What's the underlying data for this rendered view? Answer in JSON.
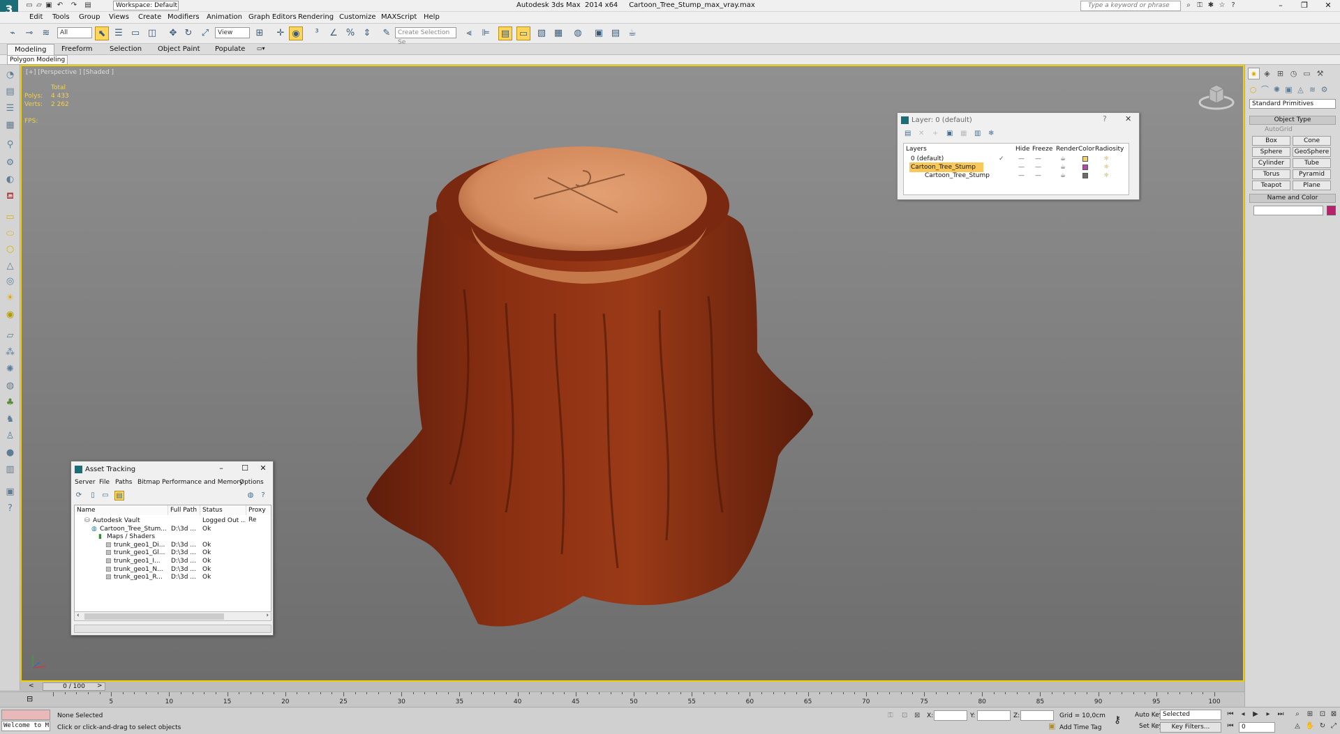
{
  "app": {
    "window_title": "Autodesk 3ds Max  2014 x64     Cartoon_Tree_Stump_max_vray.max",
    "workspace": "Workspace: Default",
    "search_placeholder": "Type a keyword or phrase"
  },
  "menu": [
    "Edit",
    "Tools",
    "Group",
    "Views",
    "Create",
    "Modifiers",
    "Animation",
    "Graph Editors",
    "Rendering",
    "Customize",
    "MAXScript",
    "Help"
  ],
  "toolbar": {
    "selection_filter": "All",
    "ref_coord": "View",
    "named_selection_placeholder": "Create Selection Se"
  },
  "ribbon": {
    "tabs": [
      "Modeling",
      "Freeform",
      "Selection",
      "Object Paint",
      "Populate"
    ],
    "panel_label": "Polygon Modeling"
  },
  "viewport": {
    "label": "[+] [Perspective ] [Shaded ]",
    "stats_header": "Total",
    "polys_label": "Polys:",
    "polys_value": "4 433",
    "verts_label": "Verts:",
    "verts_value": "2 262",
    "fps_label": "FPS:"
  },
  "timeline": {
    "frame_display": "0 / 100",
    "ticks": [
      "5",
      "10",
      "15",
      "20",
      "25",
      "30",
      "35",
      "40",
      "45",
      "50",
      "55",
      "60",
      "65",
      "70",
      "75",
      "80",
      "85",
      "90",
      "95",
      "100"
    ]
  },
  "status": {
    "maxscript_text": "Welcome to M",
    "selection_text": "None Selected",
    "prompt_text": "Click or click-and-drag to select objects",
    "x_label": "X:",
    "y_label": "Y:",
    "z_label": "Z:",
    "grid_text": "Grid = 10,0cm",
    "add_time_tag": "Add Time Tag",
    "auto_key": "Auto Key",
    "set_key": "Set Key",
    "selected_dd": "Selected",
    "key_filters": "Key Filters...",
    "current_frame": "0"
  },
  "command_panel": {
    "category": "Standard Primitives",
    "object_type_title": "Object Type",
    "autogrid_label": "AutoGrid",
    "buttons": [
      "Box",
      "Cone",
      "Sphere",
      "GeoSphere",
      "Cylinder",
      "Tube",
      "Torus",
      "Pyramid",
      "Teapot",
      "Plane"
    ],
    "name_color_title": "Name and Color",
    "object_color": "#b8216c"
  },
  "layer_dialog": {
    "title": "Layer: 0 (default)",
    "columns": [
      "Layers",
      "Hide",
      "Freeze",
      "Render",
      "Color",
      "Radiosity"
    ],
    "rows": [
      {
        "name": "0 (default)",
        "color": "#f2d36b",
        "current": "✓",
        "selected": false,
        "indent": 0
      },
      {
        "name": "Cartoon_Tree_Stump",
        "color": "#b24aa8",
        "current": "",
        "selected": true,
        "indent": 0
      },
      {
        "name": "Cartoon_Tree_Stump",
        "color": "#6c6c6c",
        "current": "",
        "selected": false,
        "indent": 1
      }
    ]
  },
  "asset_dialog": {
    "title": "Asset Tracking",
    "menus": [
      "Server",
      "File",
      "Paths",
      "Bitmap Performance and Memory",
      "Options"
    ],
    "columns": [
      "Name",
      "Full Path",
      "Status",
      "Proxy Re"
    ],
    "rows": [
      {
        "name": "Autodesk Vault",
        "path": "",
        "status": "Logged Out ...",
        "indent": 0
      },
      {
        "name": "Cartoon_Tree_Stum...",
        "path": "D:\\3d ...",
        "status": "Ok",
        "indent": 1
      },
      {
        "name": "Maps / Shaders",
        "path": "",
        "status": "",
        "indent": 2
      },
      {
        "name": "trunk_geo1_Di...",
        "path": "D:\\3d ...",
        "status": "Ok",
        "indent": 3
      },
      {
        "name": "trunk_geo1_Gl...",
        "path": "D:\\3d ...",
        "status": "Ok",
        "indent": 3
      },
      {
        "name": "trunk_geo1_I...",
        "path": "D:\\3d ...",
        "status": "Ok",
        "indent": 3
      },
      {
        "name": "trunk_geo1_N...",
        "path": "D:\\3d ...",
        "status": "Ok",
        "indent": 3
      },
      {
        "name": "trunk_geo1_R...",
        "path": "D:\\3d ...",
        "status": "Ok",
        "indent": 3
      }
    ]
  }
}
